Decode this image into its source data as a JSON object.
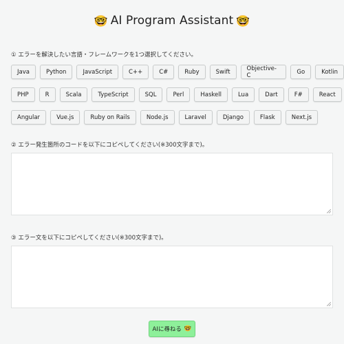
{
  "header": {
    "title": "AI Program Assistant",
    "emoji_left": "🤓",
    "emoji_right": "🤓"
  },
  "sections": {
    "language_label": "① エラーを解決したい言語・フレームワークを1つ選択してください。",
    "code_label": "② エラー発生箇所のコードを以下にコピペしてください(※300文字まで)。",
    "error_label": "③ エラー文を以下にコピペしてください(※300文字まで)。"
  },
  "languages": {
    "row1": [
      "Java",
      "Python",
      "JavaScript",
      "C++",
      "C#",
      "Ruby",
      "Swift",
      "Objective-C",
      "Go",
      "Kotlin"
    ],
    "row2": [
      "PHP",
      "R",
      "Scala",
      "TypeScript",
      "SQL",
      "Perl",
      "Haskell",
      "Lua",
      "Dart",
      "F#",
      "React"
    ],
    "row3": [
      "Angular",
      "Vue.js",
      "Ruby on Rails",
      "Node.js",
      "Laravel",
      "Django",
      "Flask",
      "Next.js"
    ]
  },
  "inputs": {
    "code_value": "",
    "error_value": ""
  },
  "submit": {
    "label": "AIに尋ねる",
    "emoji": "🤓"
  },
  "colors": {
    "submit_bg": "#8ef09a",
    "page_bg": "#f5f6f6"
  }
}
